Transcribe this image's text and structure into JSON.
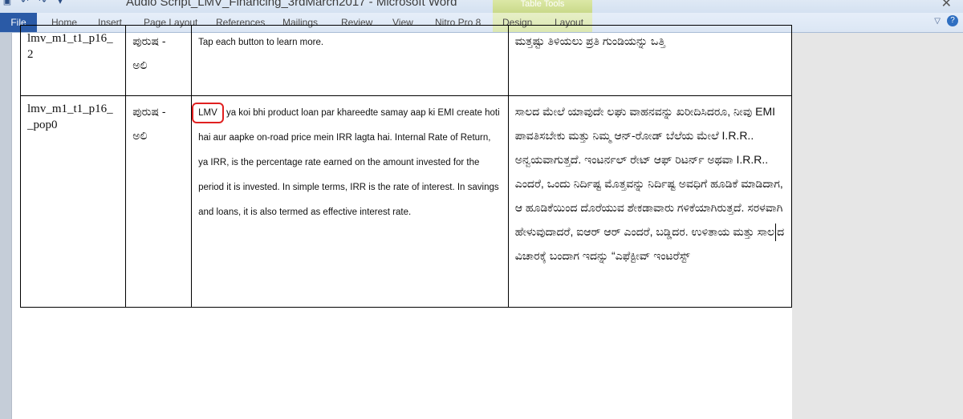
{
  "window": {
    "title": "Audio Script_LMV_Financing_3rdMarch2017 - Microsoft Word",
    "context_tab_group": "Table Tools"
  },
  "ribbon": {
    "file_label": "File",
    "tabs": [
      "Home",
      "Insert",
      "Page Layout",
      "References",
      "Mailings",
      "Review",
      "View",
      "Nitro Pro 8",
      "Design",
      "Layout"
    ]
  },
  "table": {
    "rows": [
      {
        "id": "lmv_m1_t1_p16_\n2",
        "voice": "ಪುರುಷ -\nಅಲಿ",
        "english": "Tap each button to learn more.",
        "kannada": "ಮತ್ತಷ್ಟು ತಿಳಿಯಲು ಪ್ರತಿ ಗುಂಡಿಯನ್ನು ಒತ್ತಿ"
      },
      {
        "id": "lmv_m1_t1_p16_\n_pop0",
        "voice": "ಪುರುಷ -\nಅಲಿ",
        "english_highlight": "LMV",
        "english": "ya koi bhi product loan par khareedte samay aap ki EMI create hoti hai aur aapke on-road price mein IRR lagta hai. Internal Rate of Return, ya IRR, is the percentage rate earned on the amount invested for the period it is invested. In simple terms, IRR is the rate of interest. In savings and loans, it is also termed as effective interest rate.",
        "kannada_before_cursor": "ಸಾಲದ ಮೇಲೆ ಯಾವುದೇ ಲಘು ವಾಹನವನ್ನು ಖರೀದಿಸಿದರೂ, ನೀವು EMI ಪಾವತಿಸಬೇಕು ಮತ್ತು ನಿಮ್ಮ ಆನ್-ರೋಡ್ ಬೆಲೆಯ ಮೇಲೆ I.R.R.. ಅನ್ವಯವಾಗುತ್ತದೆ. ಇಂಟರ್ನಲ್ ರೇಟ್ ಆಫ್ ರಿಟರ್ನ್ ಅಥವಾ I.R.R.. ಎಂದರೆ, ಒಂದು ನಿರ್ದಿಷ್ಟ ಮೊತ್ತವನ್ನು ನಿರ್ದಿಷ್ಟ ಅವಧಿಗೆ ಹೂಡಿಕೆ ಮಾಡಿದಾಗ, ಆ ಹೂಡಿಕೆಯಿಂದ ದೊರೆಯುವ ಶೇಕಡಾವಾರು ಗಳಿಕೆಯಾಗಿರುತ್ತದೆ. ಸರಳವಾಗಿ ಹೇಳುವುದಾದರೆ, ಐಆರ್ ಆರ್ ಎಂದರೆ, ಬಡ್ಡಿದರ. ಉಳಿತಾಯ ಮತ್ತು ಸಾಲ",
        "kannada_after_cursor": "ದ ವಿಚಾರಕ್ಕೆ ಬಂದಾಗ ಇದನ್ನು “ಎಫೆಕ್ಟೀವ್ ಇಂಟರೆಸ್ಟ್"
      }
    ]
  },
  "colors": {
    "file_tab": "#2a5aa6",
    "context_tab": "#c9d98a",
    "highlight_box": "#e02020"
  }
}
